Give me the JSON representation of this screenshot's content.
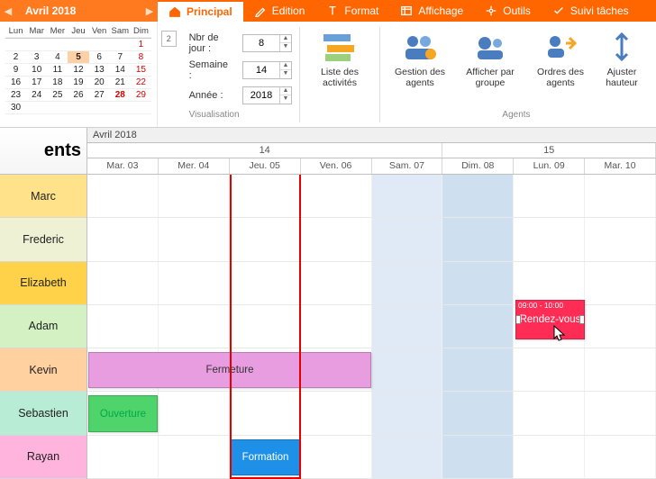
{
  "header": {
    "month_title": "Avril 2018",
    "tabs": [
      {
        "id": "principal",
        "label": "Principal",
        "active": true
      },
      {
        "id": "edition",
        "label": "Edition"
      },
      {
        "id": "format",
        "label": "Format"
      },
      {
        "id": "affichage",
        "label": "Affichage"
      },
      {
        "id": "outils",
        "label": "Outils"
      },
      {
        "id": "suivi",
        "label": "Suivi tâches"
      }
    ]
  },
  "minical": {
    "day_headers": [
      "Lun",
      "Mar",
      "Mer",
      "Jeu",
      "Ven",
      "Sam",
      "Dim"
    ],
    "rows": [
      [
        {
          "n": "",
          "other": true
        },
        {
          "n": "",
          "other": true
        },
        {
          "n": "",
          "other": true
        },
        {
          "n": "",
          "other": true
        },
        {
          "n": "",
          "other": true
        },
        {
          "n": "",
          "other": true
        },
        {
          "n": "1",
          "sunred": true
        }
      ],
      [
        {
          "n": "2"
        },
        {
          "n": "3"
        },
        {
          "n": "4"
        },
        {
          "n": "5",
          "today": true
        },
        {
          "n": "6"
        },
        {
          "n": "7"
        },
        {
          "n": "8",
          "sunred": true
        }
      ],
      [
        {
          "n": "9"
        },
        {
          "n": "10"
        },
        {
          "n": "11"
        },
        {
          "n": "12"
        },
        {
          "n": "13"
        },
        {
          "n": "14"
        },
        {
          "n": "15",
          "sunred": true
        }
      ],
      [
        {
          "n": "16"
        },
        {
          "n": "17"
        },
        {
          "n": "18"
        },
        {
          "n": "19"
        },
        {
          "n": "20"
        },
        {
          "n": "21"
        },
        {
          "n": "22",
          "sunred": true
        }
      ],
      [
        {
          "n": "23"
        },
        {
          "n": "24"
        },
        {
          "n": "25"
        },
        {
          "n": "26"
        },
        {
          "n": "27"
        },
        {
          "n": "28",
          "hol": true
        },
        {
          "n": "29",
          "sunred": true
        }
      ],
      [
        {
          "n": "30"
        },
        {
          "n": "",
          "other": true
        },
        {
          "n": "",
          "other": true
        },
        {
          "n": "",
          "other": true
        },
        {
          "n": "",
          "other": true
        },
        {
          "n": "",
          "other": true
        },
        {
          "n": "",
          "other": true
        }
      ]
    ]
  },
  "ribbon": {
    "tag_label": "2",
    "fields": {
      "nb_jour_label": "Nbr de jour :",
      "nb_jour_value": "8",
      "semaine_label": "Semaine :",
      "semaine_value": "14",
      "annee_label": "Année :",
      "annee_value": "2018"
    },
    "group_visual_label": "Visualisation",
    "group_agents_label": "Agents",
    "buttons": {
      "activities": "Liste des activités",
      "gestion": "Gestion des agents",
      "group_view": "Afficher par groupe",
      "agent_orders": "Ordres des agents",
      "fit_height": "Ajuster hauteur"
    }
  },
  "agents": {
    "title": "ents",
    "list": [
      {
        "name": "Marc",
        "color": "#ffe28a"
      },
      {
        "name": "Frederic",
        "color": "#eef1d4"
      },
      {
        "name": "Elizabeth",
        "color": "#ffd24a"
      },
      {
        "name": "Adam",
        "color": "#d4f1c4"
      },
      {
        "name": "Kevin",
        "color": "#ffd0a0"
      },
      {
        "name": "Sebastien",
        "color": "#b9ecd5"
      },
      {
        "name": "Rayan",
        "color": "#ffb4de"
      }
    ]
  },
  "grid": {
    "month_label": "Avril 2018",
    "weeks": [
      {
        "label": "14",
        "span": 5
      },
      {
        "label": "15",
        "span": 3
      }
    ],
    "days": [
      "Mar. 03",
      "Mer. 04",
      "Jeu. 05",
      "Ven. 06",
      "Sam. 07",
      "Dim. 08",
      "Lun. 09",
      "Mar. 10"
    ],
    "weekend_cols": [
      4,
      5
    ],
    "today_col": 2,
    "events": [
      {
        "id": "ouverture",
        "label": "Ouverture",
        "row": 5,
        "col_start": 0,
        "col_span": 1,
        "color": "#4fd36b",
        "text": "#0a4"
      },
      {
        "id": "fermeture",
        "label": "Fermeture",
        "row": 4,
        "col_start": 0,
        "col_span": 4,
        "color": "#e79de0",
        "text": "#333"
      },
      {
        "id": "formation",
        "label": "Formation",
        "row": 6,
        "col_start": 2,
        "col_span": 1,
        "color": "#1e90e8",
        "text": "#fff"
      },
      {
        "id": "rdv",
        "label": "Rendez-vous",
        "row": 3,
        "col_start": 6,
        "col_span": 1,
        "color": "#ff2d55",
        "text": "#fff",
        "time": "09:00 - 10:00",
        "selected": true
      }
    ]
  }
}
